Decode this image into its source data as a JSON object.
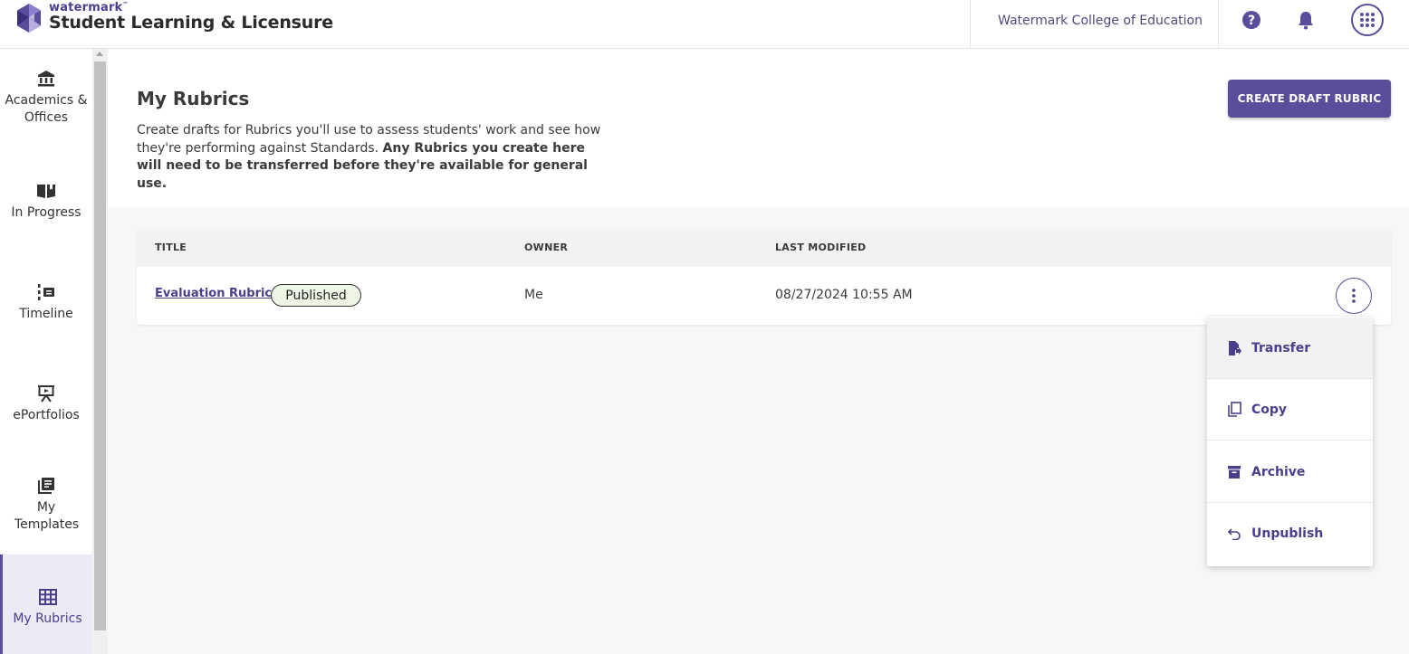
{
  "header": {
    "brand_small": "watermark",
    "brand_tm": "™",
    "brand_title": "Student Learning & Licensure",
    "institution": "Watermark College of Education",
    "icons": [
      "help-icon",
      "bell-icon",
      "apps-grid-icon"
    ]
  },
  "sidebar": {
    "items": [
      {
        "label": "Academics & Offices",
        "icon": "bank-icon"
      },
      {
        "label": "In Progress",
        "icon": "book-open-icon"
      },
      {
        "label": "Timeline",
        "icon": "timeline-icon"
      },
      {
        "label": "ePortfolios",
        "icon": "presentation-icon"
      },
      {
        "label": "My Templates",
        "icon": "templates-icon"
      },
      {
        "label": "My Rubrics",
        "icon": "grid-table-icon",
        "active": true
      }
    ]
  },
  "main": {
    "title": "My Rubrics",
    "description_plain": "Create drafts for Rubrics you'll use to assess students' work and see how they're performing against Standards.",
    "description_bold": "Any Rubrics you create here will need to be transferred before they're available for general use.",
    "create_button": "CREATE DRAFT RUBRIC"
  },
  "table": {
    "columns": [
      "TITLE",
      "OWNER",
      "LAST MODIFIED"
    ],
    "rows": [
      {
        "title": "Evaluation Rubric",
        "status": "Published",
        "owner": "Me",
        "last_modified": "08/27/2024 10:55 AM"
      }
    ]
  },
  "menu": {
    "items": [
      {
        "label": "Transfer",
        "icon": "file-transfer-icon"
      },
      {
        "label": "Copy",
        "icon": "copy-icon"
      },
      {
        "label": "Archive",
        "icon": "archive-icon"
      },
      {
        "label": "Unpublish",
        "icon": "undo-icon"
      }
    ]
  },
  "colors": {
    "accent": "#5a4d9c",
    "badge_bg": "#eef7e6",
    "page_bg": "#f7f7f7"
  }
}
